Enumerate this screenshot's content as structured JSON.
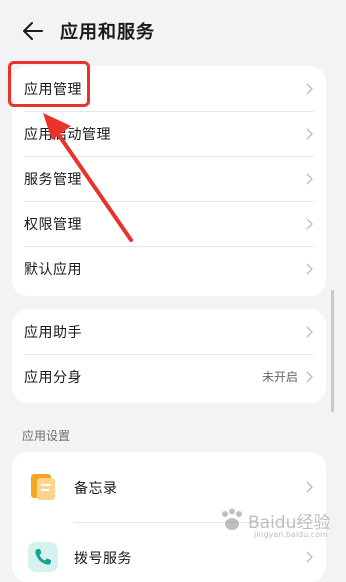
{
  "header": {
    "title": "应用和服务"
  },
  "group1": [
    {
      "label": "应用管理"
    },
    {
      "label": "应用启动管理"
    },
    {
      "label": "服务管理"
    },
    {
      "label": "权限管理"
    },
    {
      "label": "默认应用"
    }
  ],
  "group2": [
    {
      "label": "应用助手",
      "value": ""
    },
    {
      "label": "应用分身",
      "value": "未开启"
    }
  ],
  "section_label": "应用设置",
  "apps": [
    {
      "label": "备忘录",
      "icon": "notes-icon"
    },
    {
      "label": "拨号服务",
      "icon": "phone-icon"
    }
  ],
  "watermark": {
    "text": "Baidu经验",
    "sub": "jingyan.baidu.com"
  },
  "colors": {
    "annotation": "#e8322a",
    "background": "#f1f3f5",
    "card": "#ffffff"
  }
}
